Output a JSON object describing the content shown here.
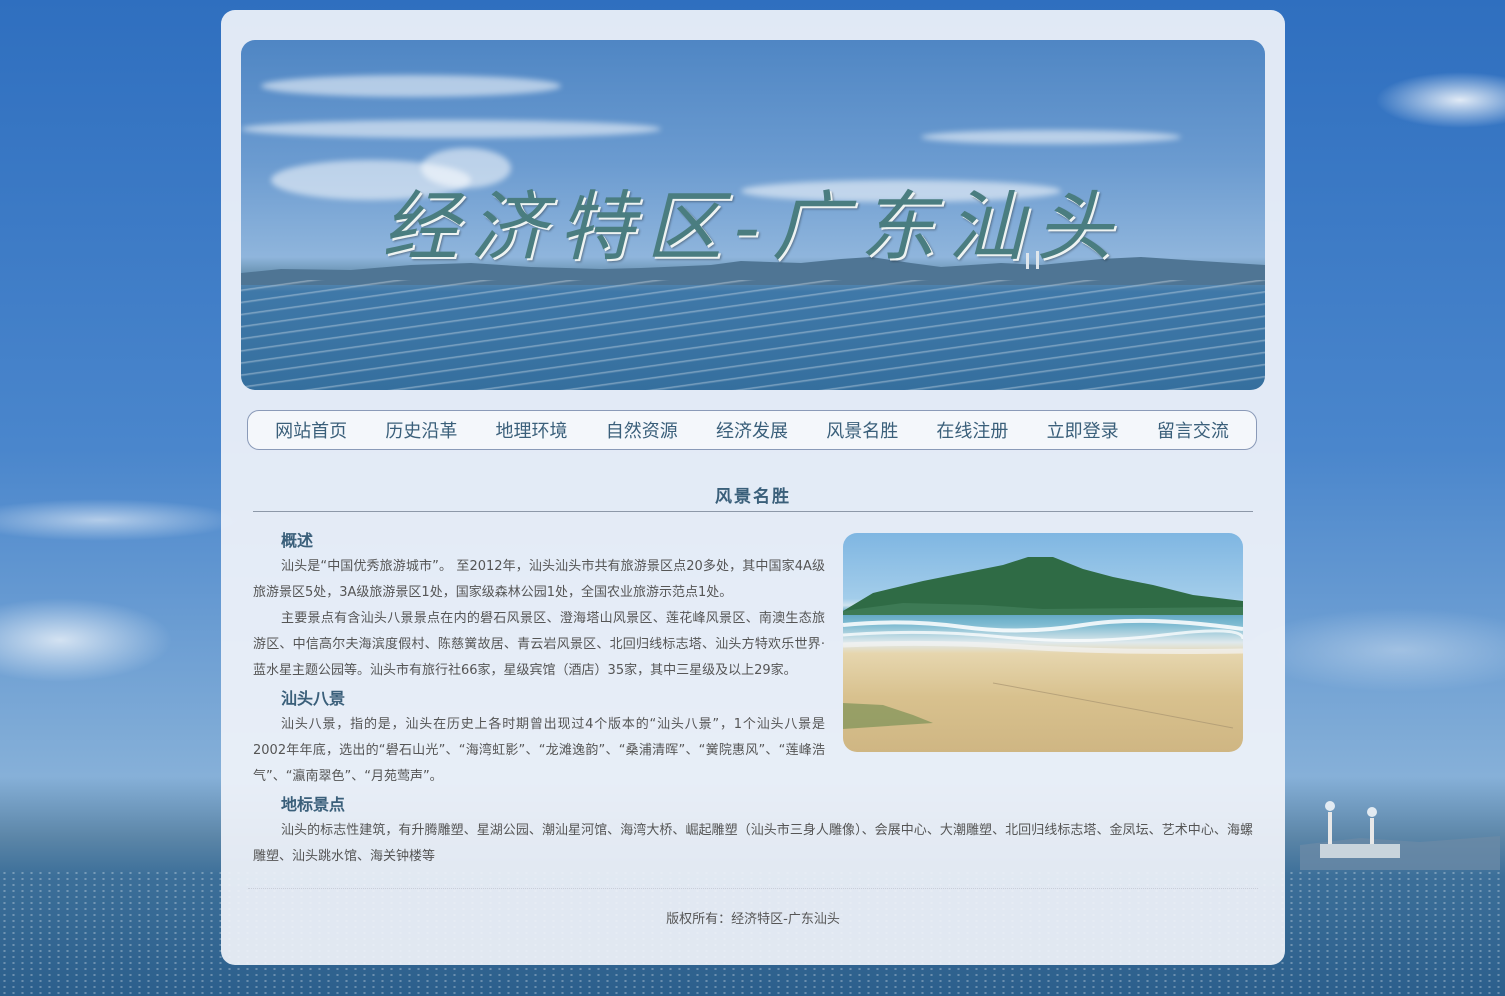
{
  "site": {
    "banner_title": "经济特区-广东汕头"
  },
  "nav": {
    "items": [
      {
        "label": "网站首页"
      },
      {
        "label": "历史沿革"
      },
      {
        "label": "地理环境"
      },
      {
        "label": "自然资源"
      },
      {
        "label": "经济发展"
      },
      {
        "label": "风景名胜"
      },
      {
        "label": "在线注册"
      },
      {
        "label": "立即登录"
      },
      {
        "label": "留言交流"
      }
    ]
  },
  "page": {
    "section_title": "风景名胜",
    "sections": [
      {
        "heading": "概述",
        "paragraphs": [
          "汕头是“中国优秀旅游城市”。 至2012年，汕头汕头市共有旅游景区点20多处，其中国家4A级旅游景区5处，3A级旅游景区1处，国家级森林公园1处，全国农业旅游示范点1处。",
          "主要景点有含汕头八景景点在内的礐石风景区、澄海塔山风景区、莲花峰风景区、南澳生态旅游区、中信高尔夫海滨度假村、陈慈黉故居、青云岩风景区、北回归线标志塔、汕头方特欢乐世界·蓝水星主题公园等。汕头市有旅行社66家，星级宾馆（酒店）35家，其中三星级及以上29家。"
        ]
      },
      {
        "heading": "汕头八景",
        "paragraphs": [
          "汕头八景，指的是，汕头在历史上各时期曾出现过4个版本的“汕头八景”，1个汕头八景是2002年年底，选出的“礐石山光”、“海湾虹影”、“龙滩逸韵”、“桑浦清晖”、“黉院惠风”、“莲峰浩气”、“瀛南翠色”、“月苑莺声”。"
        ]
      },
      {
        "heading": "地标景点",
        "paragraphs": [
          "汕头的标志性建筑，有升腾雕塑、星湖公园、潮汕星河馆、海湾大桥、崛起雕塑（汕头市三身人雕像）、会展中心、大潮雕塑、北回归线标志塔、金凤坛、艺术中心、海螺雕塑、汕头跳水馆、海关钟楼等"
        ]
      }
    ]
  },
  "footer": {
    "copyright": "版权所有：经济特区-广东汕头"
  },
  "colors": {
    "accent": "#3a5f7a",
    "body_text": "#555555",
    "container_bg": "#f0f3fa",
    "page_bg": "#3a78c0"
  }
}
